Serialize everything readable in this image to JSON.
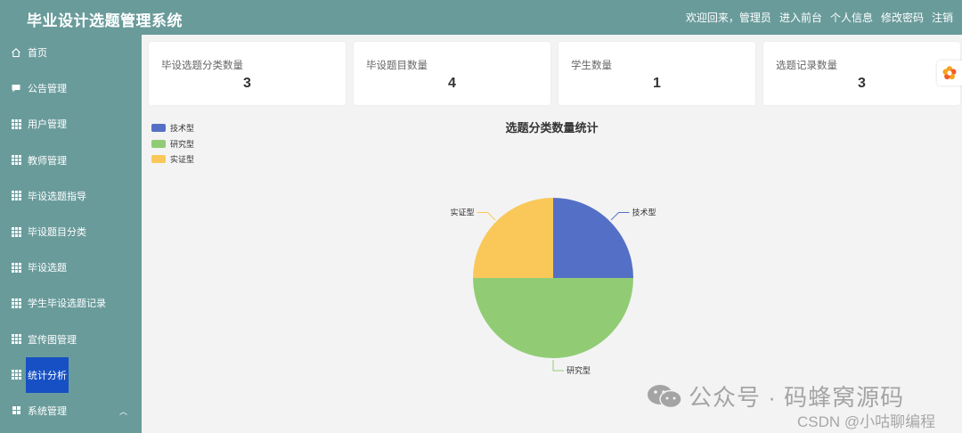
{
  "header": {
    "title": "毕业设计选题管理系统",
    "welcome": "欢迎回来，管理员",
    "links": [
      "进入前台",
      "个人信息",
      "修改密码",
      "注销"
    ]
  },
  "sidebar": {
    "items": [
      {
        "label": "首页",
        "icon": "home-icon"
      },
      {
        "label": "公告管理",
        "icon": "message-icon"
      },
      {
        "label": "用户管理",
        "icon": "grid-icon"
      },
      {
        "label": "教师管理",
        "icon": "grid-icon"
      },
      {
        "label": "毕设选题指导",
        "icon": "grid-icon"
      },
      {
        "label": "毕设题目分类",
        "icon": "grid-icon"
      },
      {
        "label": "毕设选题",
        "icon": "grid-icon"
      },
      {
        "label": "学生毕设选题记录",
        "icon": "grid-icon"
      },
      {
        "label": "宣传图管理",
        "icon": "grid-icon"
      },
      {
        "label": "统计分析",
        "icon": "grid-icon",
        "active": true
      },
      {
        "label": "系统管理",
        "icon": "apps-icon",
        "expandable": true
      }
    ]
  },
  "cards": [
    {
      "label": "毕设选题分类数量",
      "value": "3"
    },
    {
      "label": "毕设题目数量",
      "value": "4"
    },
    {
      "label": "学生数量",
      "value": "1"
    },
    {
      "label": "选题记录数量",
      "value": "3"
    }
  ],
  "chart_data": {
    "type": "pie",
    "title": "选题分类数量统计",
    "categories": [
      "技术型",
      "研究型",
      "实证型"
    ],
    "values": [
      1,
      2,
      1
    ],
    "colors": [
      "#5470c6",
      "#91cc75",
      "#fac858"
    ],
    "legend": "top-left"
  },
  "watermark": {
    "line1": "公众号 · 码蜂窝源码",
    "line2": "CSDN @小咕聊编程"
  },
  "colors": {
    "sidebar": "#6a9b9b",
    "active_item": "#1650c4"
  }
}
